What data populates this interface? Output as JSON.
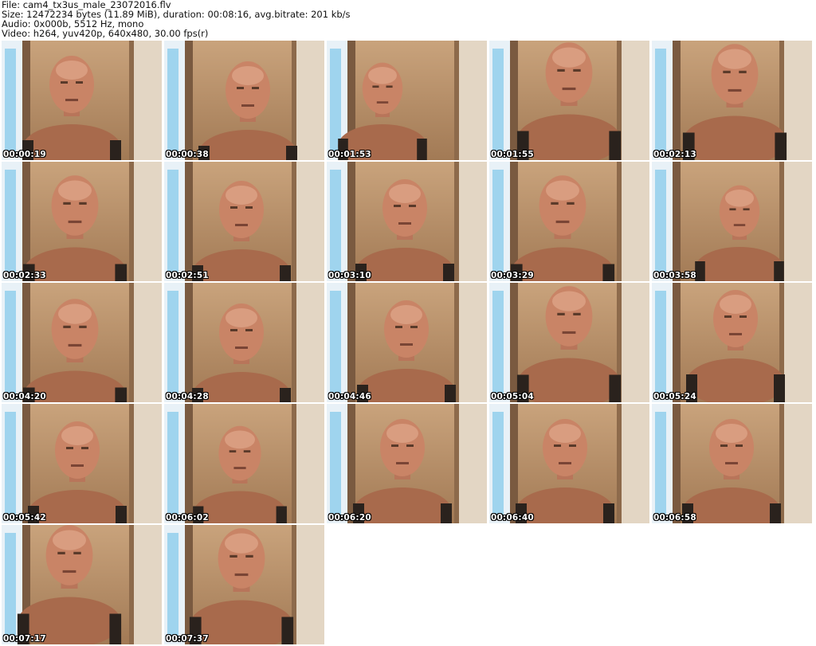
{
  "header": {
    "file_line": "File: cam4_tx3us_male_23072016.flv",
    "size_line": "Size: 12472234 bytes (11.89 MiB), duration: 00:08:16, avg.bitrate: 201 kb/s",
    "audio_line": "Audio: 0x000b, 5512 Hz, mono",
    "video_line": "Video: h264, yuv420p, 640x480, 30.00 fps(r)"
  },
  "thumbnails": [
    {
      "timestamp": "00:00:19"
    },
    {
      "timestamp": "00:00:38"
    },
    {
      "timestamp": "00:01:53"
    },
    {
      "timestamp": "00:01:55"
    },
    {
      "timestamp": "00:02:13"
    },
    {
      "timestamp": "00:02:33"
    },
    {
      "timestamp": "00:02:51"
    },
    {
      "timestamp": "00:03:10"
    },
    {
      "timestamp": "00:03:29"
    },
    {
      "timestamp": "00:03:58"
    },
    {
      "timestamp": "00:04:20"
    },
    {
      "timestamp": "00:04:28"
    },
    {
      "timestamp": "00:04:46"
    },
    {
      "timestamp": "00:05:04"
    },
    {
      "timestamp": "00:05:24"
    },
    {
      "timestamp": "00:05:42"
    },
    {
      "timestamp": "00:06:02"
    },
    {
      "timestamp": "00:06:20"
    },
    {
      "timestamp": "00:06:40"
    },
    {
      "timestamp": "00:06:58"
    },
    {
      "timestamp": "00:07:17"
    },
    {
      "timestamp": "00:07:37"
    }
  ]
}
